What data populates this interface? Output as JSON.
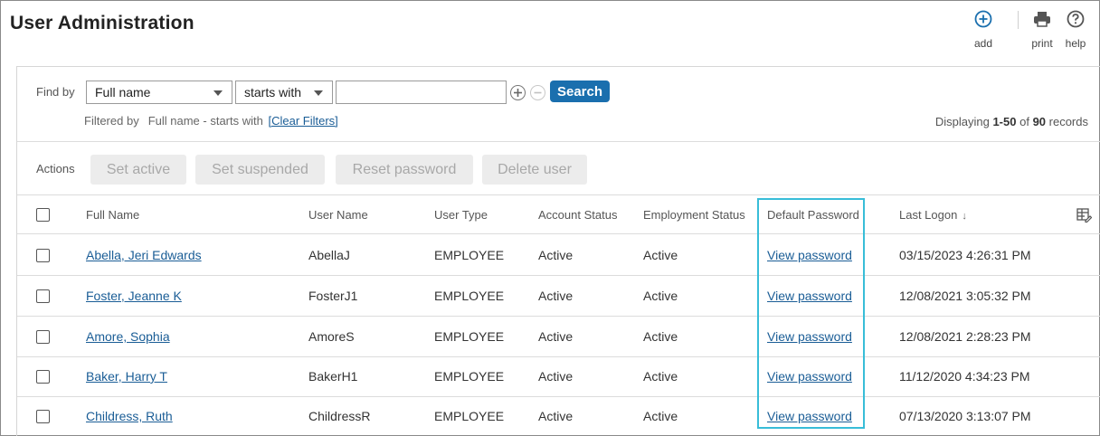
{
  "page": {
    "title": "User Administration"
  },
  "top_actions": {
    "add": "add",
    "print": "print",
    "help": "help"
  },
  "find": {
    "label": "Find by",
    "field": "Full name",
    "operator": "starts with",
    "value": "",
    "search_label": "Search",
    "filtered_by_label": "Filtered by",
    "filter_desc": "Full name - starts with",
    "clear_filters": "[Clear Filters]",
    "records_prefix": "Displaying ",
    "records_range": "1-50",
    "records_of": " of ",
    "records_total": "90",
    "records_suffix": " records"
  },
  "actions": {
    "label": "Actions",
    "set_active": "Set active",
    "set_suspended": "Set suspended",
    "reset_password": "Reset password",
    "delete_user": "Delete user"
  },
  "table": {
    "headers": {
      "full_name": "Full Name",
      "user_name": "User Name",
      "user_type": "User Type",
      "account_status": "Account Status",
      "employment_status": "Employment Status",
      "default_password": "Default Password",
      "last_logon": "Last Logon"
    },
    "rows": [
      {
        "full_name": "Abella, Jeri Edwards",
        "user_name": "AbellaJ",
        "user_type": "EMPLOYEE",
        "account_status": "Active",
        "employment_status": "Active",
        "password_link": "View password",
        "last_logon": "03/15/2023 4:26:31 PM"
      },
      {
        "full_name": "Foster, Jeanne K",
        "user_name": "FosterJ1",
        "user_type": "EMPLOYEE",
        "account_status": "Active",
        "employment_status": "Active",
        "password_link": "View password",
        "last_logon": "12/08/2021 3:05:32 PM"
      },
      {
        "full_name": "Amore, Sophia",
        "user_name": "AmoreS",
        "user_type": "EMPLOYEE",
        "account_status": "Active",
        "employment_status": "Active",
        "password_link": "View password",
        "last_logon": "12/08/2021 2:28:23 PM"
      },
      {
        "full_name": "Baker, Harry T",
        "user_name": "BakerH1",
        "user_type": "EMPLOYEE",
        "account_status": "Active",
        "employment_status": "Active",
        "password_link": "View password",
        "last_logon": "11/12/2020 4:34:23 PM"
      },
      {
        "full_name": "Childress, Ruth",
        "user_name": "ChildressR",
        "user_type": "EMPLOYEE",
        "account_status": "Active",
        "employment_status": "Active",
        "password_link": "View password",
        "last_logon": "07/13/2020 3:13:07 PM"
      }
    ]
  },
  "colors": {
    "accent": "#1a6fae",
    "link": "#1a5d96",
    "highlight": "#38bdd8",
    "disabled_button_bg": "#ececec"
  },
  "icons": {
    "add": "plus-circle-icon",
    "print": "printer-icon",
    "help": "question-circle-icon",
    "columns": "column-settings-icon",
    "sort": "sort-descending-icon"
  }
}
